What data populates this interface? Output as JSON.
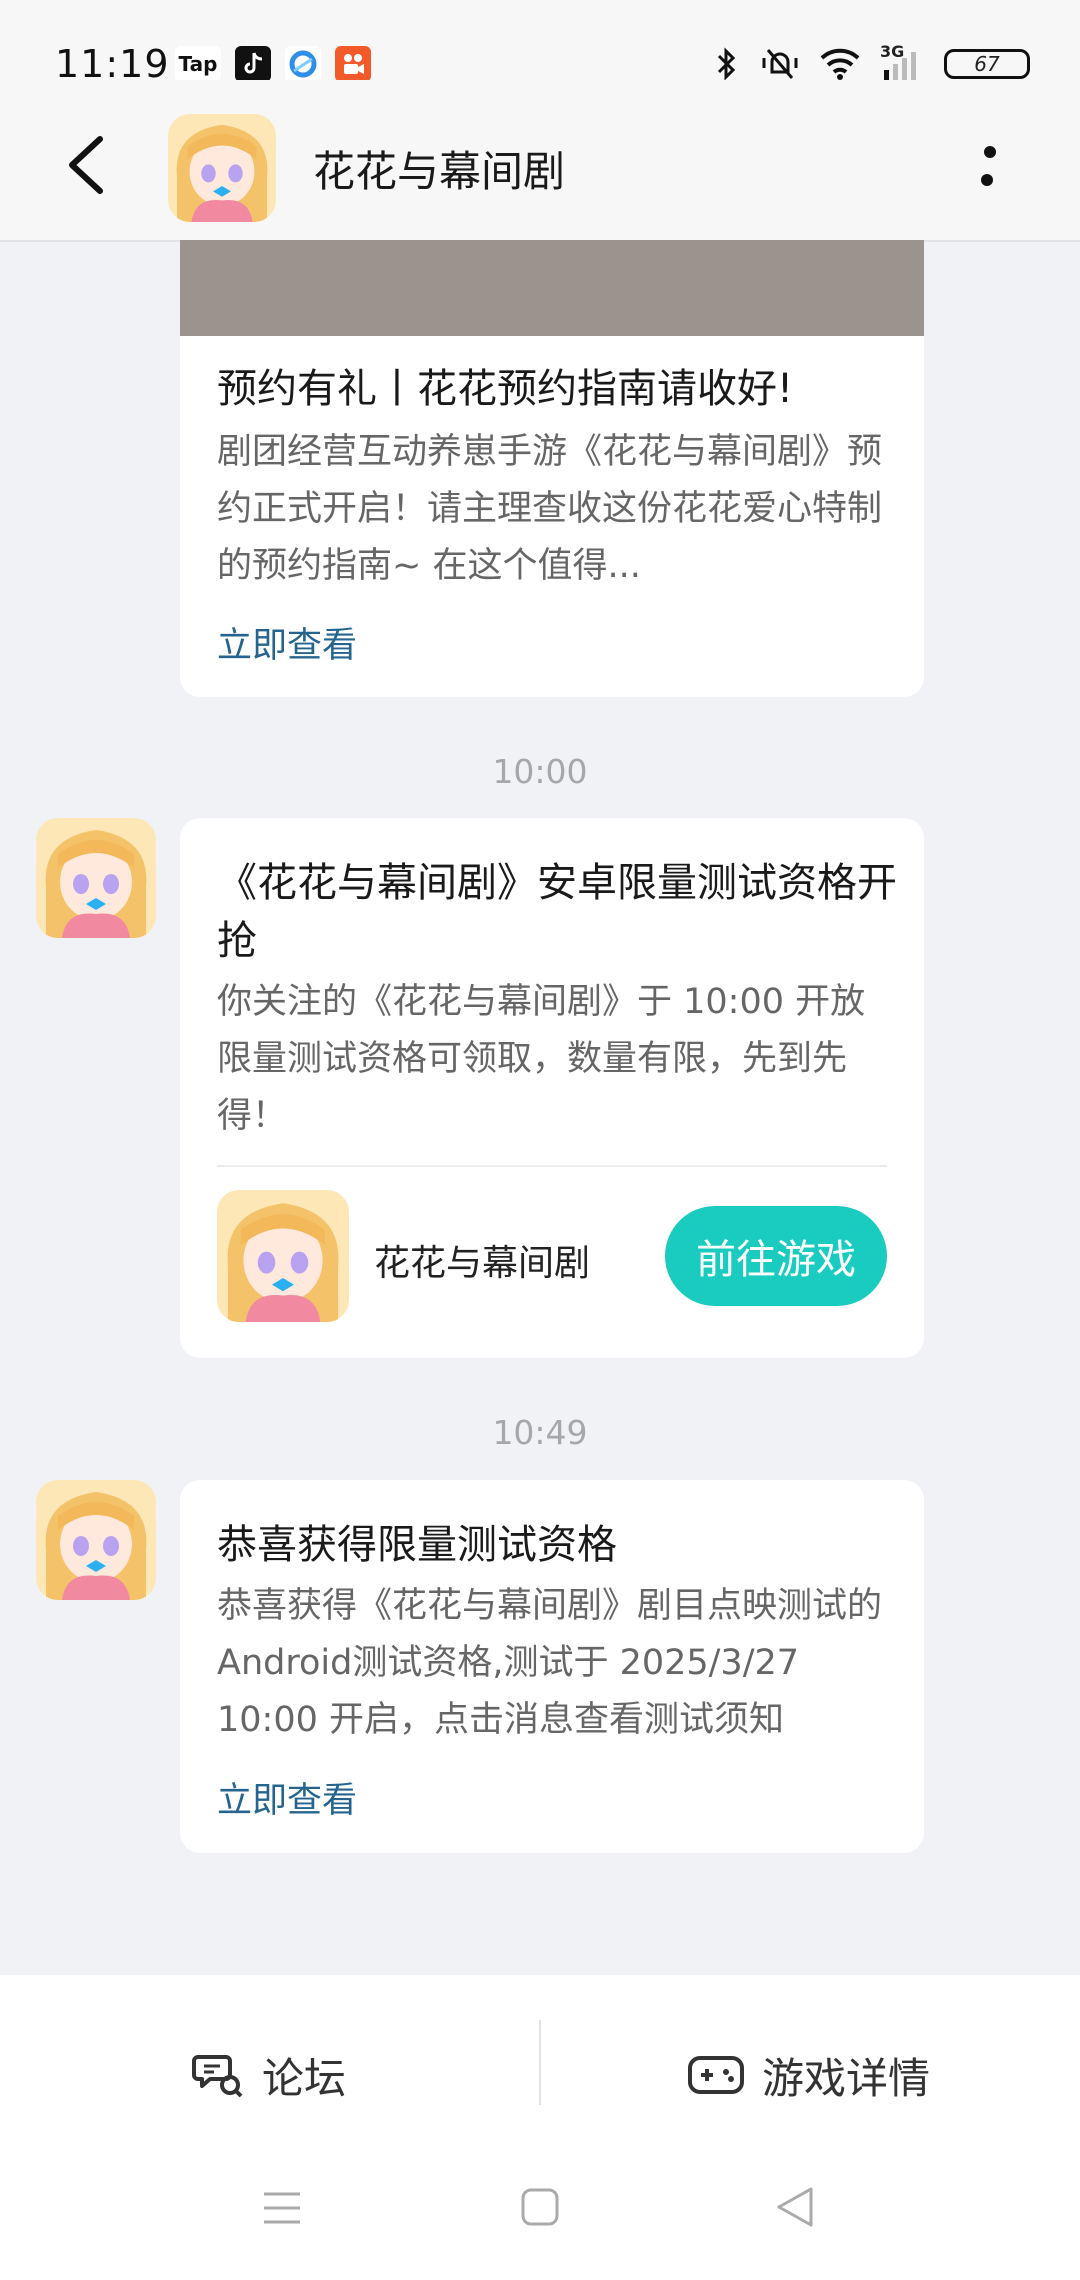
{
  "status_bar": {
    "time": "11:19",
    "app_icons": [
      "tap-icon",
      "tiktok-icon",
      "browser-icon",
      "kuaishou-icon"
    ],
    "tap_label": "Tap",
    "network": "3G",
    "battery": "67"
  },
  "header": {
    "title": "花花与幕间剧"
  },
  "messages": [
    {
      "title": "预约有礼丨花花预约指南请收好!",
      "body": "剧团经营互动养崽手游《花花与幕间剧》预约正式开启！请主理查收这份花花爱心特制的预约指南~ 在这个值得...",
      "link": "立即查看"
    },
    {
      "time": "10:00",
      "title": "《花花与幕间剧》安卓限量测试资格开抢",
      "body": "你关注的《花花与幕间剧》于 10:00 开放限量测试资格可领取，数量有限，先到先得！",
      "game_name": "花花与幕间剧",
      "button": "前往游戏"
    },
    {
      "time": "10:49",
      "title": "恭喜获得限量测试资格",
      "body": "恭喜获得《花花与幕间剧》剧目点映测试的Android测试资格,测试于 2025/3/27 10:00 开启，点击消息查看测试须知",
      "link": "立即查看"
    }
  ],
  "bottom_bar": {
    "forum_label": "论坛",
    "details_label": "游戏详情"
  },
  "colors": {
    "accent": "#19ccbf",
    "link": "#25648f",
    "background": "#f1f2f5"
  }
}
